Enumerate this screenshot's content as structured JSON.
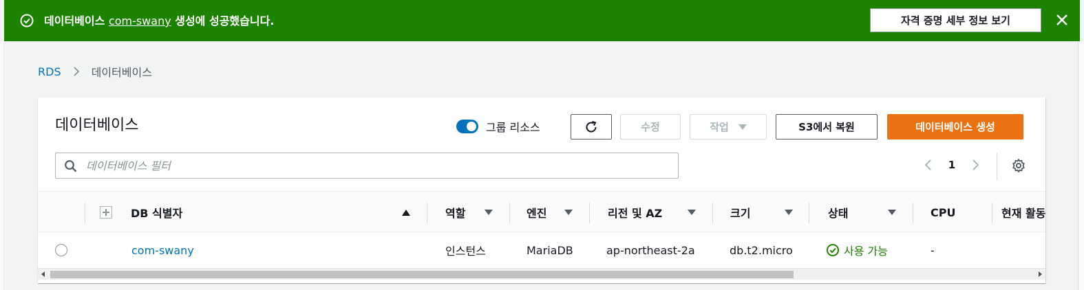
{
  "flash": {
    "prefix": "데이터베이스 ",
    "db_link": "com-swany",
    "suffix": " 생성에 성공했습니다.",
    "cred_button": "자격 증명 세부 정보 보기",
    "background": "#1d8102"
  },
  "breadcrumb": {
    "root": "RDS",
    "current": "데이터베이스"
  },
  "panel": {
    "title": "데이터베이스",
    "group_toggle_label": "그룹 리소스",
    "group_toggle_on": true,
    "modify_label": "수정",
    "actions_label": "작업",
    "restore_label": "S3에서 복원",
    "create_label": "데이터베이스 생성",
    "filter_placeholder": "데이터베이스 필터",
    "filter_value": "",
    "page": "1",
    "accent": "#ec7211",
    "link_color": "#0073bb"
  },
  "table": {
    "headers": {
      "db_id": "DB 식별자",
      "role": "역할",
      "engine": "엔진",
      "region": "리전 및 AZ",
      "size": "크기",
      "status": "상태",
      "cpu": "CPU",
      "activity": "현재 활동"
    },
    "rows": [
      {
        "db_id": "com-swany",
        "role": "인스턴스",
        "engine": "MariaDB",
        "region": "ap-northeast-2a",
        "size": "db.t2.micro",
        "status": "사용 가능",
        "cpu": "-"
      }
    ]
  }
}
